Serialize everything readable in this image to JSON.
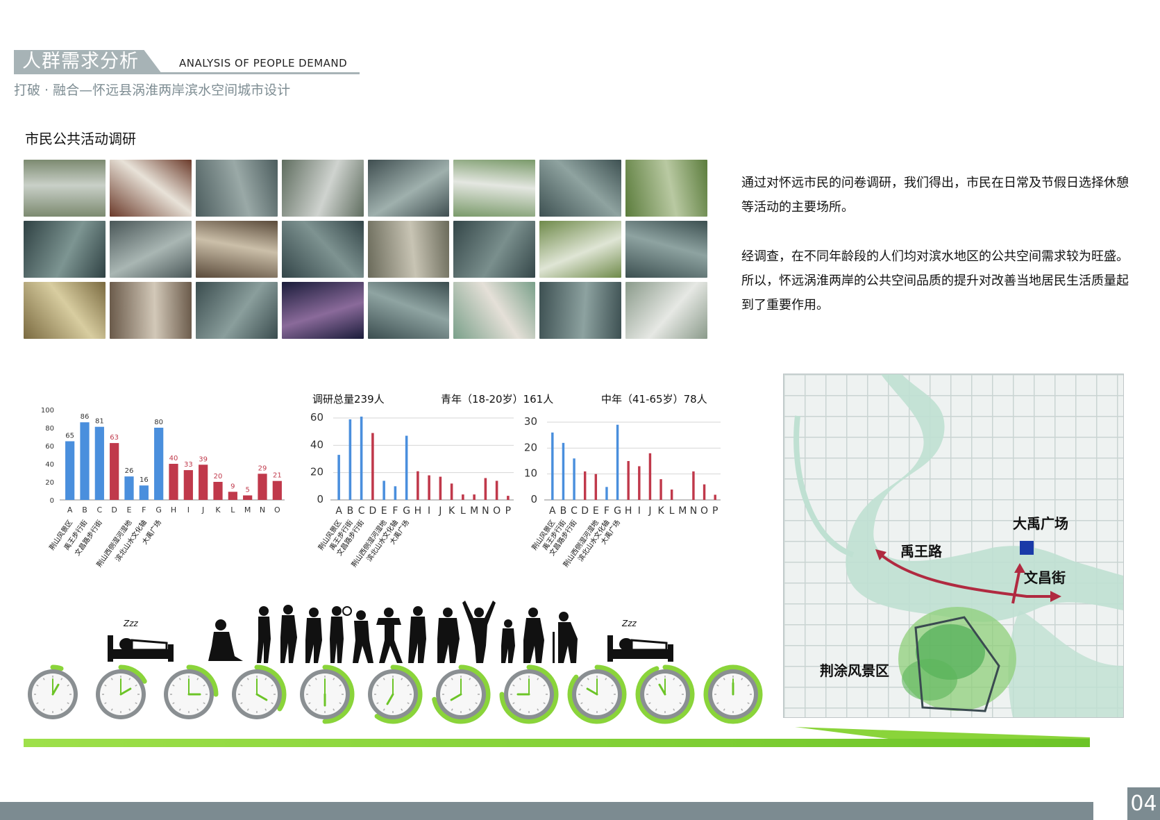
{
  "header": {
    "title_cn": "人群需求分析",
    "title_en": "ANALYSIS OF PEOPLE DEMAND",
    "subtitle": "打破 · 融合—怀远县涡淮两岸滨水空间城市设计"
  },
  "section_title": "市民公共活动调研",
  "photos": [
    {
      "id": "p1",
      "colors": [
        "#7c8a70",
        "#c9d0c8"
      ]
    },
    {
      "id": "p2",
      "colors": [
        "#6b3a2a",
        "#e8e2d8"
      ]
    },
    {
      "id": "p3",
      "colors": [
        "#4c5d5e",
        "#9aa9a7"
      ]
    },
    {
      "id": "p4",
      "colors": [
        "#5f6d5f",
        "#cfd3cf"
      ]
    },
    {
      "id": "p5",
      "colors": [
        "#3f4e50",
        "#9fb0ad"
      ]
    },
    {
      "id": "p6",
      "colors": [
        "#7a9a6a",
        "#e4e7e1"
      ]
    },
    {
      "id": "p7",
      "colors": [
        "#3e5152",
        "#8fa3a0"
      ]
    },
    {
      "id": "p8",
      "colors": [
        "#5b7c3c",
        "#b9c9a2"
      ]
    },
    {
      "id": "p9",
      "colors": [
        "#2f4143",
        "#7d9592"
      ]
    },
    {
      "id": "p10",
      "colors": [
        "#4a5758",
        "#a9b6b3"
      ]
    },
    {
      "id": "p11",
      "colors": [
        "#5a4a3a",
        "#cbbfa9"
      ]
    },
    {
      "id": "p12",
      "colors": [
        "#334548",
        "#7e9391"
      ]
    },
    {
      "id": "p13",
      "colors": [
        "#6a6a5a",
        "#c8c4b4"
      ]
    },
    {
      "id": "p14",
      "colors": [
        "#344648",
        "#7a8f8d"
      ]
    },
    {
      "id": "p15",
      "colors": [
        "#6f8a4a",
        "#dfe5d5"
      ]
    },
    {
      "id": "p16",
      "colors": [
        "#3c4f50",
        "#8ea3a1"
      ]
    },
    {
      "id": "p17",
      "colors": [
        "#7a6a40",
        "#d8cda0"
      ]
    },
    {
      "id": "p18",
      "colors": [
        "#6a5a4a",
        "#d2c8b8"
      ]
    },
    {
      "id": "p19",
      "colors": [
        "#3a4c4e",
        "#8a9e9c"
      ]
    },
    {
      "id": "p20",
      "colors": [
        "#1a1c3a",
        "#8a6a9a"
      ]
    },
    {
      "id": "p21",
      "colors": [
        "#3b4d4f",
        "#8fa4a2"
      ]
    },
    {
      "id": "p22",
      "colors": [
        "#7aa08a",
        "#e5e0d8"
      ]
    },
    {
      "id": "p23",
      "colors": [
        "#3d5052",
        "#8da2a0"
      ]
    },
    {
      "id": "p24",
      "colors": [
        "#8a9a8a",
        "#e6e8e4"
      ]
    }
  ],
  "description": {
    "p1": "通过对怀远市民的问卷调研，我们得出，市民在日常及节假日选择休憩等活动的主要场所。",
    "p2": "经调查，在不同年龄段的人们均对滨水地区的公共空间需求较为旺盛。所以，怀远涡淮两岸的公共空间品质的提升对改善当地居民生活质量起到了重要作用。"
  },
  "colors": {
    "blue": "#4a8fdd",
    "red": "#c0394b",
    "green": "#8ad43a",
    "gray": "#7c8b91"
  },
  "chart_labels_common": [
    "荆山风景区",
    "禹王步行街",
    "文昌路步行街",
    "",
    "荆山西侧湿河湿地",
    "滨北山水文化轴",
    "大禹广场"
  ],
  "chart_data": [
    {
      "type": "bar",
      "title": "",
      "categories": [
        "A",
        "B",
        "C",
        "D",
        "E",
        "F",
        "G",
        "H",
        "I",
        "J",
        "K",
        "L",
        "M",
        "N",
        "O"
      ],
      "values": [
        65,
        86,
        81,
        63,
        26,
        16,
        80,
        40,
        33,
        39,
        20,
        9,
        5,
        29,
        21
      ],
      "value_labels": [
        "65",
        "86",
        "81",
        "63",
        "26",
        "16",
        "80",
        "40",
        "33",
        "39",
        "20",
        "9",
        "5",
        "29",
        "21"
      ],
      "colors": [
        "blue",
        "blue",
        "blue",
        "red",
        "blue",
        "blue",
        "blue",
        "red",
        "red",
        "red",
        "red",
        "red",
        "red",
        "red",
        "red"
      ],
      "ylim": [
        0,
        100
      ],
      "yticks": [
        "0",
        "20",
        "40",
        "60",
        "80",
        "100"
      ],
      "grid": false
    },
    {
      "type": "bar",
      "title": "调研总量239人",
      "subtitle": "青年（18-20岁）161人",
      "categories": [
        "A",
        "B",
        "C",
        "D",
        "E",
        "F",
        "G",
        "H",
        "I",
        "J",
        "K",
        "L",
        "M",
        "N",
        "O",
        "P"
      ],
      "values": [
        33,
        59,
        61,
        49,
        14,
        10,
        47,
        21,
        18,
        17,
        12,
        4,
        4,
        16,
        14,
        3
      ],
      "colors": [
        "blue",
        "blue",
        "blue",
        "red",
        "blue",
        "blue",
        "blue",
        "red",
        "red",
        "red",
        "red",
        "red",
        "red",
        "red",
        "red",
        "red"
      ],
      "ylim": [
        0,
        60
      ],
      "yticks": [
        "0",
        "20",
        "40",
        "60"
      ],
      "grid": true
    },
    {
      "type": "bar",
      "title": "中年（41-65岁）78人",
      "categories": [
        "A",
        "B",
        "C",
        "D",
        "E",
        "F",
        "G",
        "H",
        "I",
        "J",
        "K",
        "L",
        "M",
        "N",
        "O",
        "P"
      ],
      "values": [
        26,
        22,
        16,
        11,
        10,
        5,
        29,
        15,
        13,
        18,
        8,
        4,
        0,
        11,
        6,
        2
      ],
      "colors": [
        "blue",
        "blue",
        "blue",
        "red",
        "red",
        "blue",
        "blue",
        "red",
        "red",
        "red",
        "red",
        "red",
        "red",
        "red",
        "red",
        "red"
      ],
      "ylim": [
        0,
        30
      ],
      "yticks": [
        "0",
        "10",
        "20",
        "30"
      ],
      "grid": true
    }
  ],
  "clocks": [
    {
      "fraction": 0.05,
      "hour": 1
    },
    {
      "fraction": 0.17,
      "hour": 2
    },
    {
      "fraction": 0.25,
      "hour": 3
    },
    {
      "fraction": 0.34,
      "hour": 4
    },
    {
      "fraction": 0.5,
      "hour": 6
    },
    {
      "fraction": 0.6,
      "hour": 7
    },
    {
      "fraction": 0.72,
      "hour": 8
    },
    {
      "fraction": 0.75,
      "hour": 9
    },
    {
      "fraction": 0.86,
      "hour": 10
    },
    {
      "fraction": 0.95,
      "hour": 11
    },
    {
      "fraction": 1.0,
      "hour": 12
    }
  ],
  "map": {
    "labels": {
      "square": "大禹广场",
      "yuwang": "禹王路",
      "wenchang": "文昌街",
      "scenic": "荆涂风景区"
    }
  },
  "page_number": "04"
}
